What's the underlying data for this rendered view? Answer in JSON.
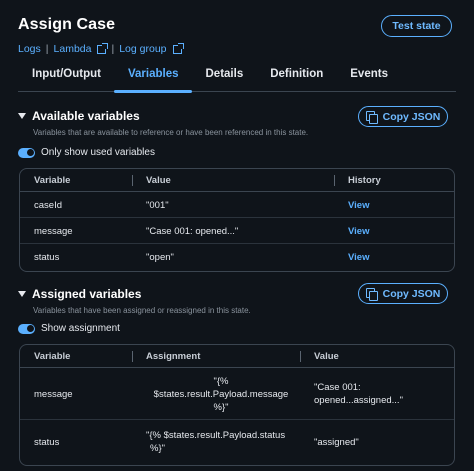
{
  "header": {
    "title": "Assign Case",
    "links": [
      "Logs",
      "Lambda",
      "Log group"
    ],
    "test_state_label": "Test state"
  },
  "tabs": [
    {
      "label": "Input/Output",
      "active": false
    },
    {
      "label": "Variables",
      "active": true
    },
    {
      "label": "Details",
      "active": false
    },
    {
      "label": "Definition",
      "active": false
    },
    {
      "label": "Events",
      "active": false
    }
  ],
  "available": {
    "title": "Available variables",
    "description": "Variables that are available to reference or have been referenced in this state.",
    "copy_label": "Copy JSON",
    "toggle_label": "Only show used variables",
    "columns": [
      "Variable",
      "Value",
      "History"
    ],
    "rows": [
      {
        "variable": "caseId",
        "value": "\"001\"",
        "history": "View"
      },
      {
        "variable": "message",
        "value": "\"Case 001: opened...\"",
        "history": "View"
      },
      {
        "variable": "status",
        "value": "\"open\"",
        "history": "View"
      }
    ]
  },
  "assigned": {
    "title": "Assigned variables",
    "description": "Variables that have been assigned or reassigned in this state.",
    "copy_label": "Copy JSON",
    "toggle_label": "Show assignment",
    "columns": [
      "Variable",
      "Assignment",
      "Value"
    ],
    "rows": [
      {
        "variable": "message",
        "assignment_1": "\"{%",
        "assignment_2": "$states.result.Payload.message",
        "assignment_3": "%}\"",
        "value_1": "\"Case 001:",
        "value_2": "opened...assigned...\""
      },
      {
        "variable": "status",
        "assignment_1": "\"{% $states.result.Payload.status",
        "assignment_2": "%}\"",
        "value_1": "\"assigned\""
      }
    ]
  },
  "colors": {
    "accent": "#5bb0ff",
    "background": "#0f141a",
    "border": "#3b4550"
  },
  "icons": [
    "external-link-icon",
    "copy-icon",
    "caret-down-icon",
    "toggle-switch"
  ]
}
